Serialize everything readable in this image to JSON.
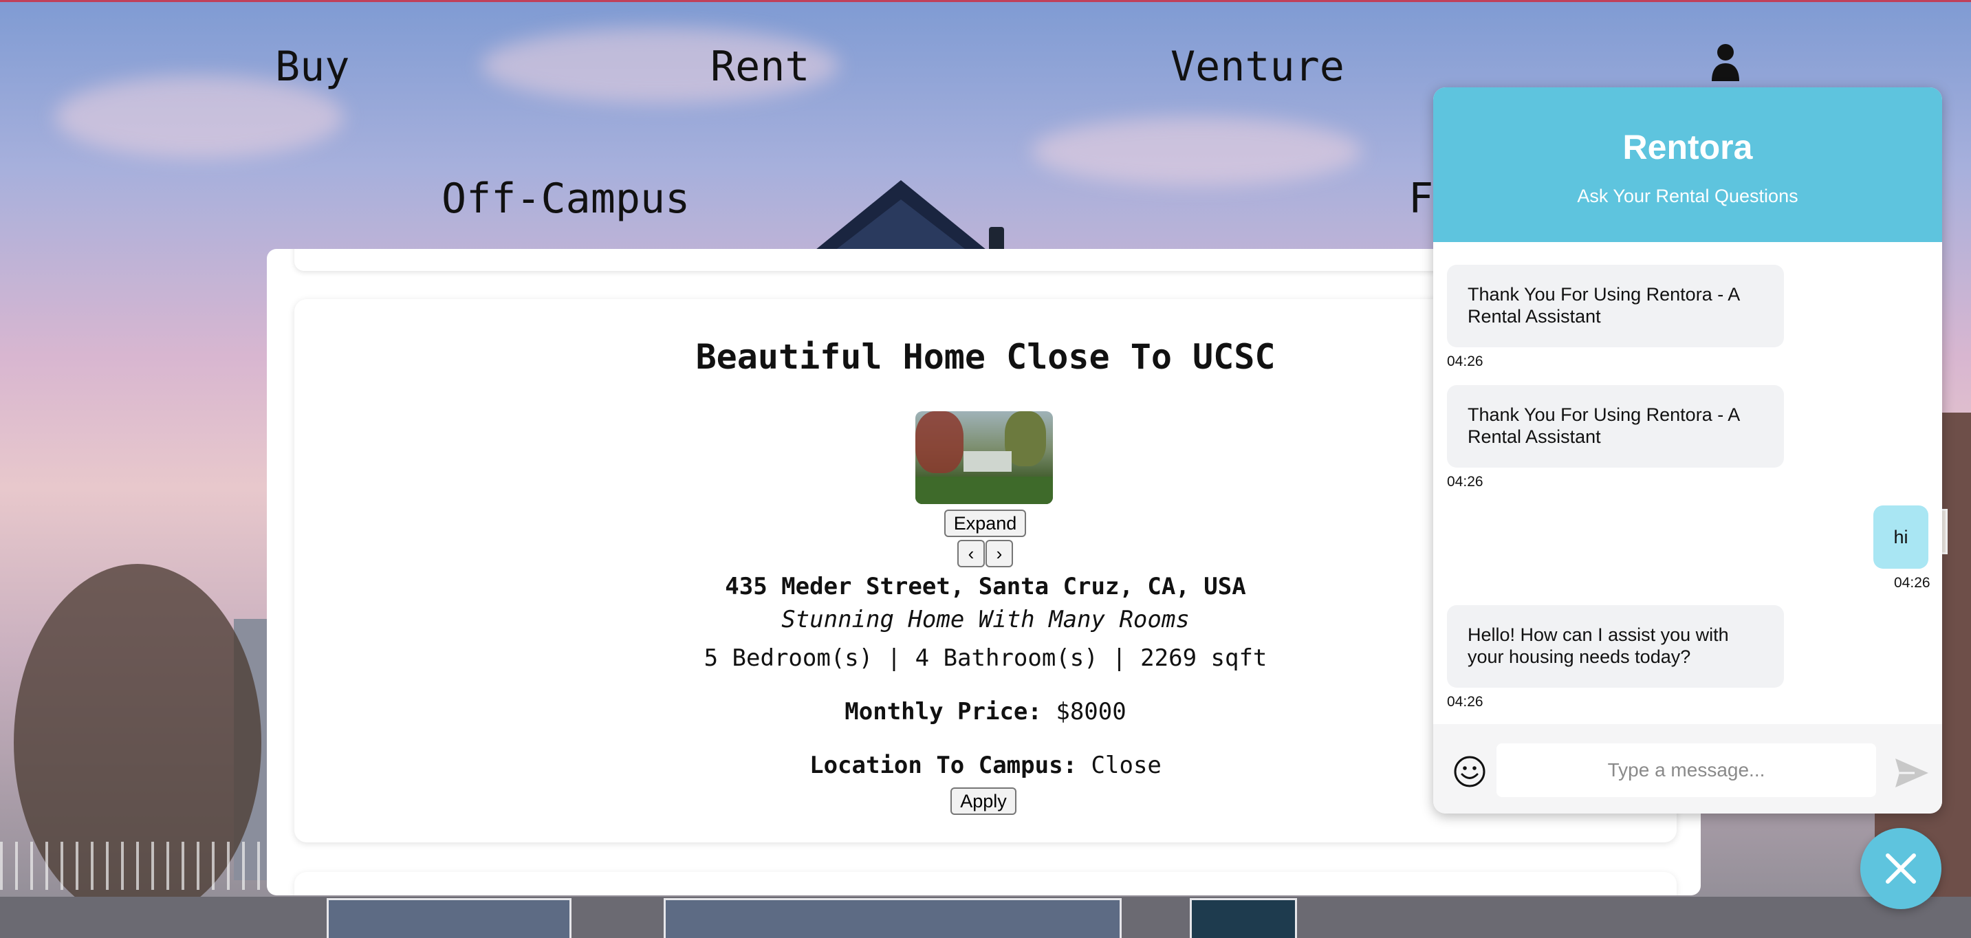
{
  "nav": {
    "buy": "Buy",
    "rent": "Rent",
    "venture": "Venture",
    "off_campus": "Off-Campus",
    "partial": "F"
  },
  "listing": {
    "title": "Beautiful Home Close To UCSC",
    "expand_label": "Expand",
    "prev_label": "‹",
    "next_label": "›",
    "address": "435 Meder Street, Santa Cruz, CA, USA",
    "description": "Stunning Home With Many Rooms",
    "specs": "5 Bedroom(s) | 4 Bathroom(s) | 2269 sqft",
    "price_label": "Monthly Price:",
    "price_value": "$8000",
    "location_label": "Location To Campus:",
    "location_value": "Close",
    "apply_label": "Apply"
  },
  "chat": {
    "title": "Rentora",
    "subtitle": "Ask Your Rental Questions",
    "messages": [
      {
        "from": "bot",
        "text": "Thank You For Using Rentora - A Rental Assistant",
        "time": "04:26"
      },
      {
        "from": "bot",
        "text": "Thank You For Using Rentora - A Rental Assistant",
        "time": "04:26"
      },
      {
        "from": "user",
        "text": "hi",
        "time": "04:26"
      },
      {
        "from": "bot",
        "text": "Hello! How can I assist you with your housing needs today?",
        "time": "04:26"
      }
    ],
    "input_placeholder": "Type a message..."
  },
  "colors": {
    "accent": "#5ec4de",
    "user_bubble": "#a9e6f3",
    "bot_bubble": "#f1f2f4"
  },
  "icons": {
    "user": "user-icon",
    "emoji": "smiley-icon",
    "send": "send-icon",
    "close": "close-icon"
  }
}
